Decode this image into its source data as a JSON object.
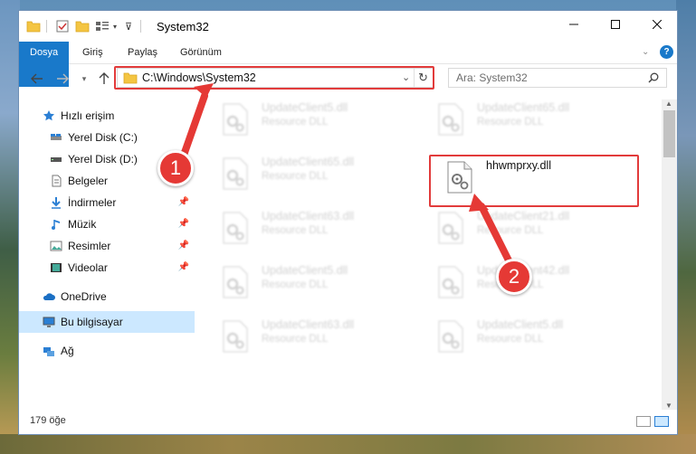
{
  "window": {
    "title": "System32"
  },
  "ribbon": {
    "tabs": [
      "Dosya",
      "Giriş",
      "Paylaş",
      "Görünüm"
    ]
  },
  "address": {
    "path": "C:\\Windows\\System32"
  },
  "search": {
    "placeholder": "Ara: System32"
  },
  "sidebar": {
    "items": [
      {
        "label": "Hızlı erişim",
        "icon": "star-icon"
      },
      {
        "label": "Yerel Disk (C:)",
        "icon": "drive-icon"
      },
      {
        "label": "Yerel Disk (D:)",
        "icon": "drive-icon"
      },
      {
        "label": "Belgeler",
        "icon": "document-icon"
      },
      {
        "label": "İndirmeler",
        "icon": "download-icon"
      },
      {
        "label": "Müzik",
        "icon": "music-icon"
      },
      {
        "label": "Resimler",
        "icon": "pictures-icon"
      },
      {
        "label": "Videolar",
        "icon": "video-icon"
      },
      {
        "label": "OneDrive",
        "icon": "cloud-icon"
      },
      {
        "label": "Bu bilgisayar",
        "icon": "computer-icon"
      },
      {
        "label": "Ağ",
        "icon": "network-icon"
      }
    ]
  },
  "files": [
    {
      "name": "UpdateClient5.dll",
      "type": "Resource DLL"
    },
    {
      "name": "UpdateClient65.dll",
      "type": "Resource DLL"
    },
    {
      "name": "UpdateClient65.dll",
      "type": "Resource DLL"
    },
    {
      "name": "hhwmprxy.dll",
      "type": ""
    },
    {
      "name": "UpdateClient63.dll",
      "type": "Resource DLL"
    },
    {
      "name": "UpdateClient21.dll",
      "type": "Resource DLL"
    },
    {
      "name": "UpdateClient5.dll",
      "type": "Resource DLL"
    },
    {
      "name": "UpdateClient42.dll",
      "type": "Resource DLL"
    },
    {
      "name": "UpdateClient63.dll",
      "type": "Resource DLL"
    },
    {
      "name": "UpdateClient5.dll",
      "type": "Resource DLL"
    }
  ],
  "status": {
    "count": "179 öğe"
  },
  "annotations": {
    "badge1": "1",
    "badge2": "2"
  },
  "colors": {
    "accent": "#1979ca",
    "highlight": "#e23b3b",
    "selection": "#cce8ff"
  }
}
